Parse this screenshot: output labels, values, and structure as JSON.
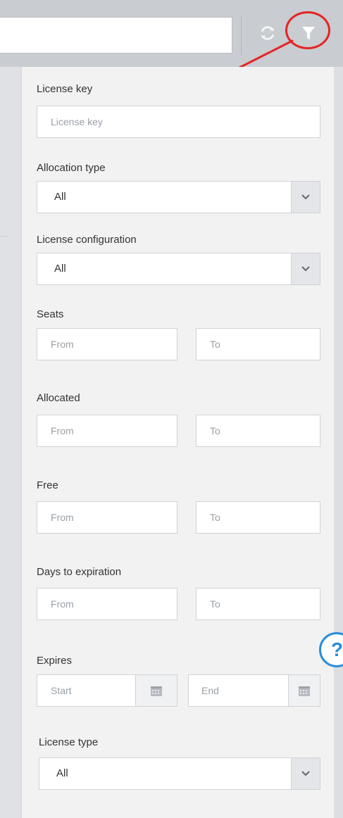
{
  "toolbar": {
    "search_value": "",
    "refresh_icon": "refresh-icon",
    "filter_icon": "filter-icon"
  },
  "filters": {
    "license_key": {
      "label": "License key",
      "placeholder": "License key"
    },
    "allocation_type": {
      "label": "Allocation type",
      "value": "All"
    },
    "license_configuration": {
      "label": "License configuration",
      "value": "All"
    },
    "seats": {
      "label": "Seats",
      "from_placeholder": "From",
      "to_placeholder": "To"
    },
    "allocated": {
      "label": "Allocated",
      "from_placeholder": "From",
      "to_placeholder": "To"
    },
    "free": {
      "label": "Free",
      "from_placeholder": "From",
      "to_placeholder": "To"
    },
    "days_to_expiration": {
      "label": "Days to expiration",
      "from_placeholder": "From",
      "to_placeholder": "To"
    },
    "expires": {
      "label": "Expires",
      "start_placeholder": "Start",
      "end_placeholder": "End"
    },
    "license_type": {
      "label": "License type",
      "value": "All"
    }
  },
  "help": {
    "glyph": "?"
  },
  "colors": {
    "annotation": "#e52424",
    "help": "#2a8dd8"
  }
}
